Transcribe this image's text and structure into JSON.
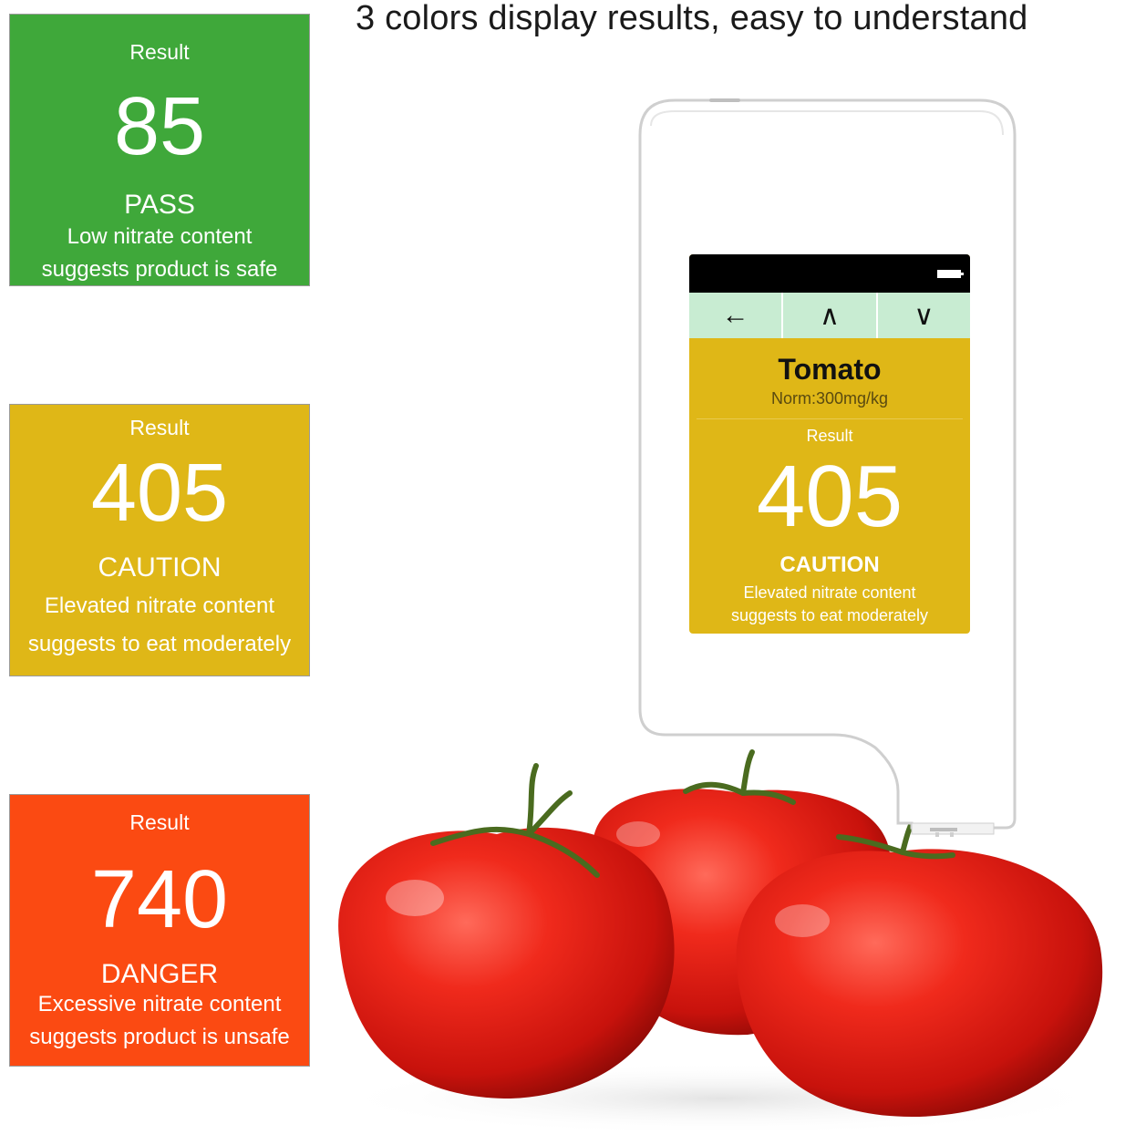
{
  "headline": "3 colors display results,  easy to understand",
  "colors": {
    "pass": "#3fa83a",
    "caution": "#dfb717",
    "danger": "#fb4a12"
  },
  "cards": {
    "pass": {
      "label": "Result",
      "value": "85",
      "status": "PASS",
      "desc_line1": "Low nitrate content",
      "desc_line2": "suggests product is safe"
    },
    "caution": {
      "label": "Result",
      "value": "405",
      "status": "CAUTION",
      "desc_line1": "Elevated nitrate content",
      "desc_line2": "suggests to eat moderately"
    },
    "danger": {
      "label": "Result",
      "value": "740",
      "status": "DANGER",
      "desc_line1": "Excessive nitrate content",
      "desc_line2": "suggests product is unsafe"
    }
  },
  "device": {
    "nav": {
      "back_icon": "←",
      "up_icon": "∧",
      "down_icon": "∨"
    },
    "product": "Tomato",
    "norm": "Norm:300mg/kg",
    "label": "Result",
    "value": "405",
    "status": "CAUTION",
    "desc_line1": "Elevated nitrate content",
    "desc_line2": "suggests to eat moderately"
  }
}
